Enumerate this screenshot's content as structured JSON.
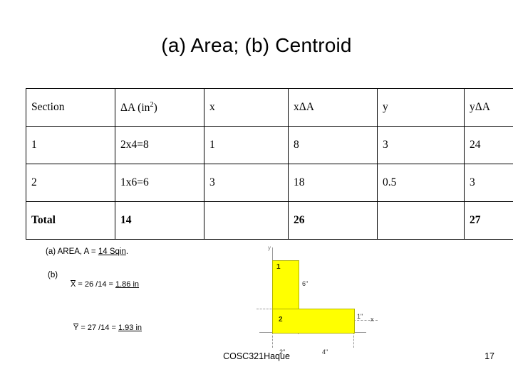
{
  "slide": {
    "title": "(a) Area; (b) Centroid",
    "footer_center": "COSC321Haque",
    "footer_page": "17"
  },
  "table": {
    "headers": [
      "Section",
      "ΔA (in2)",
      "x",
      "xΔA",
      "y",
      "yΔA"
    ],
    "header_area_unit_base": "ΔA (in",
    "header_area_unit_sup": "2",
    "header_area_unit_close": ")",
    "rows": [
      {
        "section": "1",
        "area": "2x4=8",
        "x": "1",
        "xA": "8",
        "y": "3",
        "yA": "24"
      },
      {
        "section": "2",
        "area": "1x6=6",
        "x": "3",
        "xA": "18",
        "y": "0.5",
        "yA": "3"
      }
    ],
    "total": {
      "section": "Total",
      "area": "14",
      "x": "",
      "xA": "26",
      "y": "",
      "yA": "27"
    }
  },
  "notes": {
    "area_line_prefix": "(a) AREA, A = ",
    "area_line_value": "14 Sqin",
    "area_line_suffix": ".",
    "b_label": "(b)",
    "x_symbol": "X",
    "x_equation": " = 26 /14 = ",
    "x_result": "1.86 in",
    "y_symbol": "Y",
    "y_equation": " = 27 /14 = ",
    "y_result": "1.93  in"
  },
  "figure": {
    "rect1_label": "1",
    "rect2_label": "2",
    "axis_y_label": "y",
    "axis_x_label": "x",
    "dim_rect1_height": "6\"",
    "dim_rect2_height": "1\"",
    "dim_rect2_left": "2\"",
    "dim_rect2_right": "4\""
  }
}
